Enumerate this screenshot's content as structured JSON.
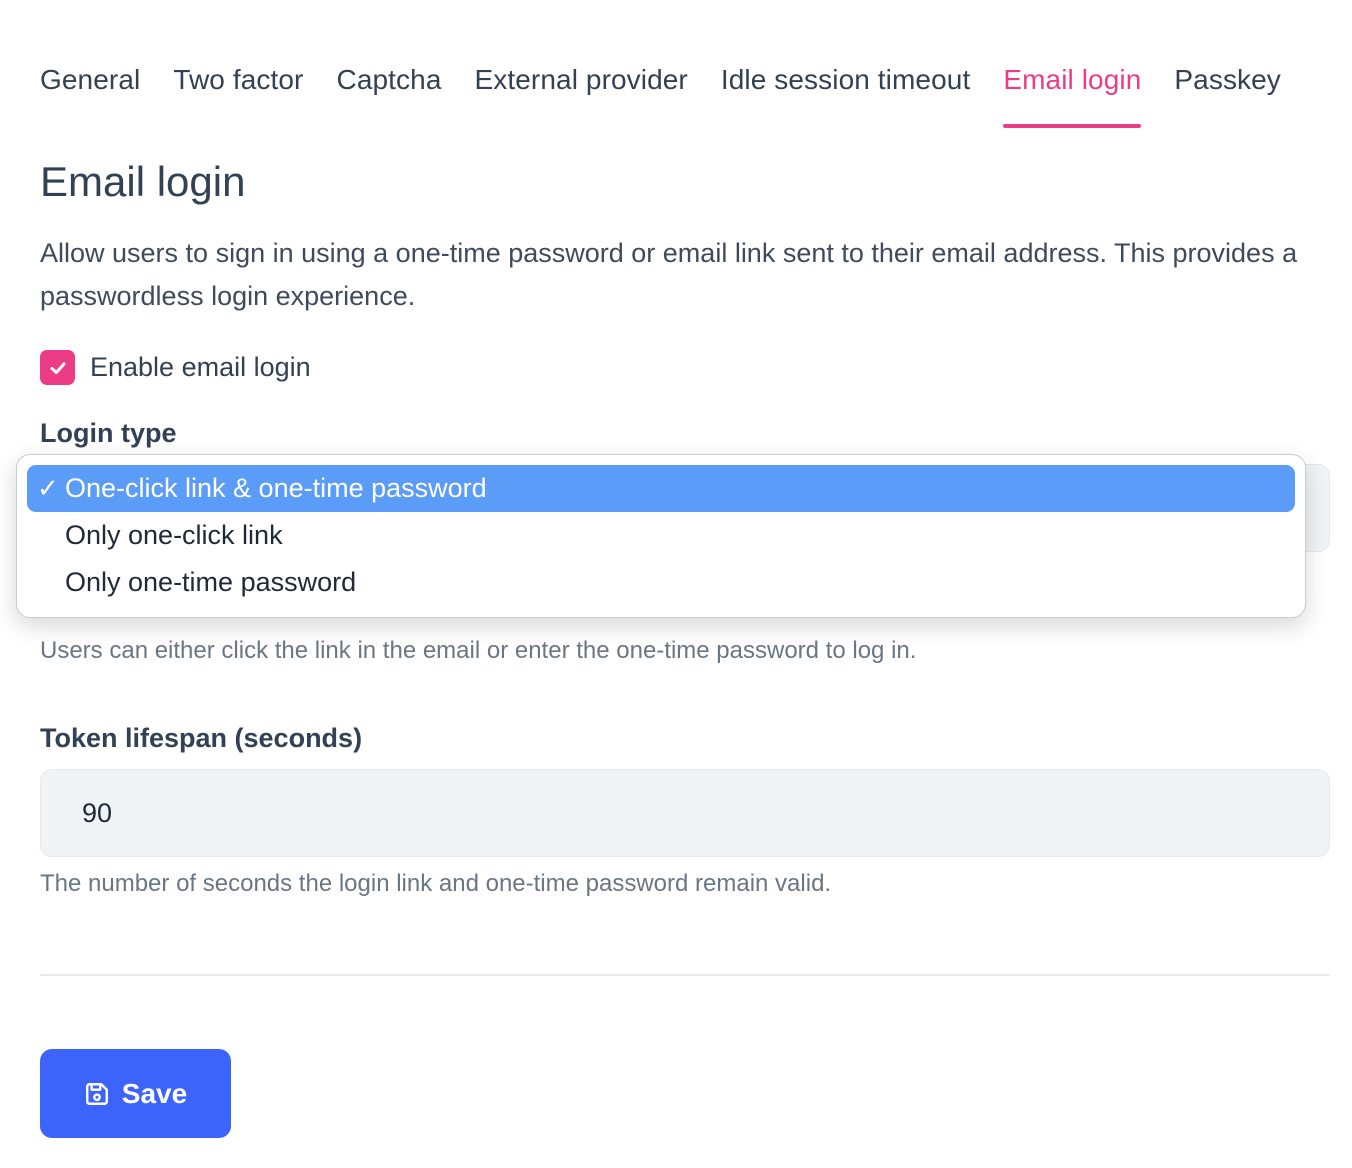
{
  "tabs": [
    {
      "label": "General"
    },
    {
      "label": "Two factor"
    },
    {
      "label": "Captcha"
    },
    {
      "label": "External provider"
    },
    {
      "label": "Idle session timeout"
    },
    {
      "label": "Email login",
      "active": true
    },
    {
      "label": "Passkey"
    }
  ],
  "section": {
    "title": "Email login",
    "description": "Allow users to sign in using a one-time password or email link sent to their email address. This provides a passwordless login experience."
  },
  "enable": {
    "label": "Enable email login",
    "checked": true
  },
  "login_type": {
    "label": "Login type",
    "tick": "✓",
    "options": [
      {
        "label": "One-click link & one-time password",
        "selected": true
      },
      {
        "label": "Only one-click link"
      },
      {
        "label": "Only one-time password"
      }
    ],
    "hint": "Users can either click the link in the email or enter the one-time password to log in."
  },
  "token": {
    "label": "Token lifespan (seconds)",
    "value": "90",
    "hint": "The number of seconds the login link and one-time password remain valid."
  },
  "save": {
    "label": "Save",
    "icon": "save-icon"
  },
  "colors": {
    "accent": "#ec3c86",
    "primary_button": "#3c64fb",
    "selected_option": "#5b9cf8"
  }
}
